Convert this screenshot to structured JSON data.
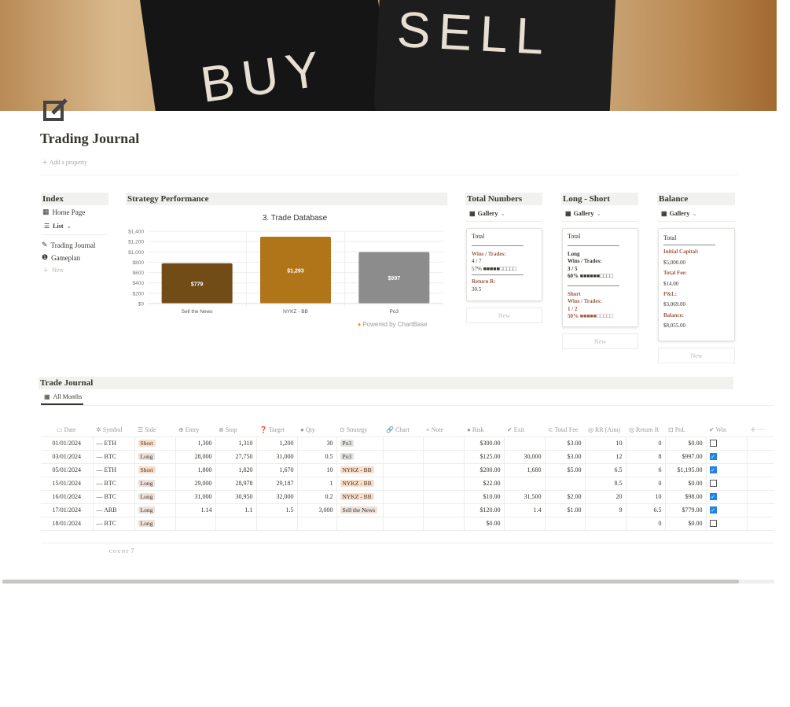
{
  "cover": {
    "words": [
      "BUY",
      "SELL"
    ]
  },
  "page": {
    "title": "Trading Journal",
    "add_property": "Add a property"
  },
  "index": {
    "title": "Index",
    "home": "Home Page",
    "view": "List",
    "items": [
      "Trading Journal",
      "Gameplan"
    ],
    "new": "New"
  },
  "strategy": {
    "title": "Strategy Performance",
    "powered": "Powered by ChartBase"
  },
  "chart_data": {
    "type": "bar",
    "title": "3. Trade Database",
    "categories": [
      "Sell the News",
      "NYKZ - BB",
      "Po3"
    ],
    "values": [
      779,
      1293,
      997
    ],
    "labels": [
      "$779",
      "$1,293",
      "$997"
    ],
    "colors": [
      "#724c17",
      "#b07518",
      "#8c8c8c"
    ],
    "ylim": [
      0,
      1400
    ],
    "yticks": [
      "$0",
      "$200",
      "$400",
      "$600",
      "$800",
      "$1,000",
      "$1,200",
      "$1,400"
    ],
    "grid": true
  },
  "total_numbers": {
    "title": "Total Numbers",
    "view": "Gallery",
    "card": {
      "title": "Total",
      "wins_label": "Wins / Trades:",
      "wins": "4 / 7",
      "pct": "57% ■■■■■□□□□□",
      "return_label": "Return R:",
      "return": "30.5"
    },
    "new": "New"
  },
  "long_short": {
    "title": "Long - Short",
    "view": "Gallery",
    "card": {
      "title": "Total",
      "long": "Long",
      "long_wins_label": "Wins / Trades:",
      "long_wins": "3 / 5",
      "long_pct": "60% ■■■■■■□□□□",
      "short": "Short",
      "short_wins_label": "Wins / Trades:",
      "short_wins": "1 / 2",
      "short_pct": "50% ■■■■■□□□□□"
    },
    "new": "New"
  },
  "balance": {
    "title": "Balance",
    "view": "Gallery",
    "card": {
      "title": "Total",
      "capital_label": "Initial Capital:",
      "capital": "$5,000.00",
      "fee_label": "Total Fee:",
      "fee": "$14.00",
      "pnl_label": "P&L:",
      "pnl": "$3,069.00",
      "balance_label": "Balance:",
      "balance": "$8,055.00"
    },
    "new": "New"
  },
  "journal": {
    "title": "Trade Journal",
    "view": "All Months",
    "count_label": "COUNT",
    "count": "7",
    "columns": [
      "Date",
      "Symbol",
      "Side",
      "Entry",
      "Stop",
      "Target",
      "Qty",
      "Strategy",
      "Chart",
      "Note",
      "Risk",
      "Exit",
      "Total Fee",
      "RR (Aim)",
      "Return R",
      "PnL",
      "Win"
    ],
    "rows": [
      [
        "01/01/2024",
        "ETH",
        "Short",
        "1,300",
        "1,310",
        "1,200",
        "30",
        "Po3",
        "",
        "",
        "$300.00",
        "",
        "$3.00",
        "10",
        "0",
        "$0.00",
        false
      ],
      [
        "03/01/2024",
        "BTC",
        "Long",
        "28,000",
        "27,750",
        "31,000",
        "0.5",
        "Po3",
        "",
        "",
        "$125.00",
        "30,000",
        "$3.00",
        "12",
        "8",
        "$997.00",
        true
      ],
      [
        "05/01/2024",
        "ETH",
        "Short",
        "1,800",
        "1,820",
        "1,670",
        "10",
        "NYKZ - BB",
        "",
        "",
        "$200.00",
        "1,680",
        "$5.00",
        "6.5",
        "6",
        "$1,195.00",
        true
      ],
      [
        "15/01/2024",
        "BTC",
        "Long",
        "29,000",
        "28,978",
        "29,187",
        "1",
        "NYKZ - BB",
        "",
        "",
        "$22.00",
        "",
        "",
        "8.5",
        "0",
        "$0.00",
        false
      ],
      [
        "16/01/2024",
        "BTC",
        "Long",
        "31,000",
        "30,950",
        "32,000",
        "0.2",
        "NYKZ - BB",
        "",
        "",
        "$10.00",
        "31,500",
        "$2.00",
        "20",
        "10",
        "$98.00",
        true
      ],
      [
        "17/01/2024",
        "ARB",
        "Long",
        "1.14",
        "1.1",
        "1.5",
        "3,000",
        "Sell the News",
        "",
        "",
        "$120.00",
        "1.4",
        "$1.00",
        "9",
        "6.5",
        "$779.00",
        true
      ],
      [
        "18/01/2024",
        "BTC",
        "Long",
        "",
        "",
        "",
        "",
        "",
        "",
        "",
        "$0.00",
        "",
        "",
        "",
        "0",
        "$0.00",
        false
      ]
    ]
  },
  "colors": {
    "short_tag": "#fbdcc6",
    "long_tag": "#eee0da",
    "po3_tag": "#e3e2e0",
    "nykz_tag": "#fadec9",
    "stn_tag": "#eee0da",
    "checkbox": "#2383e2"
  }
}
